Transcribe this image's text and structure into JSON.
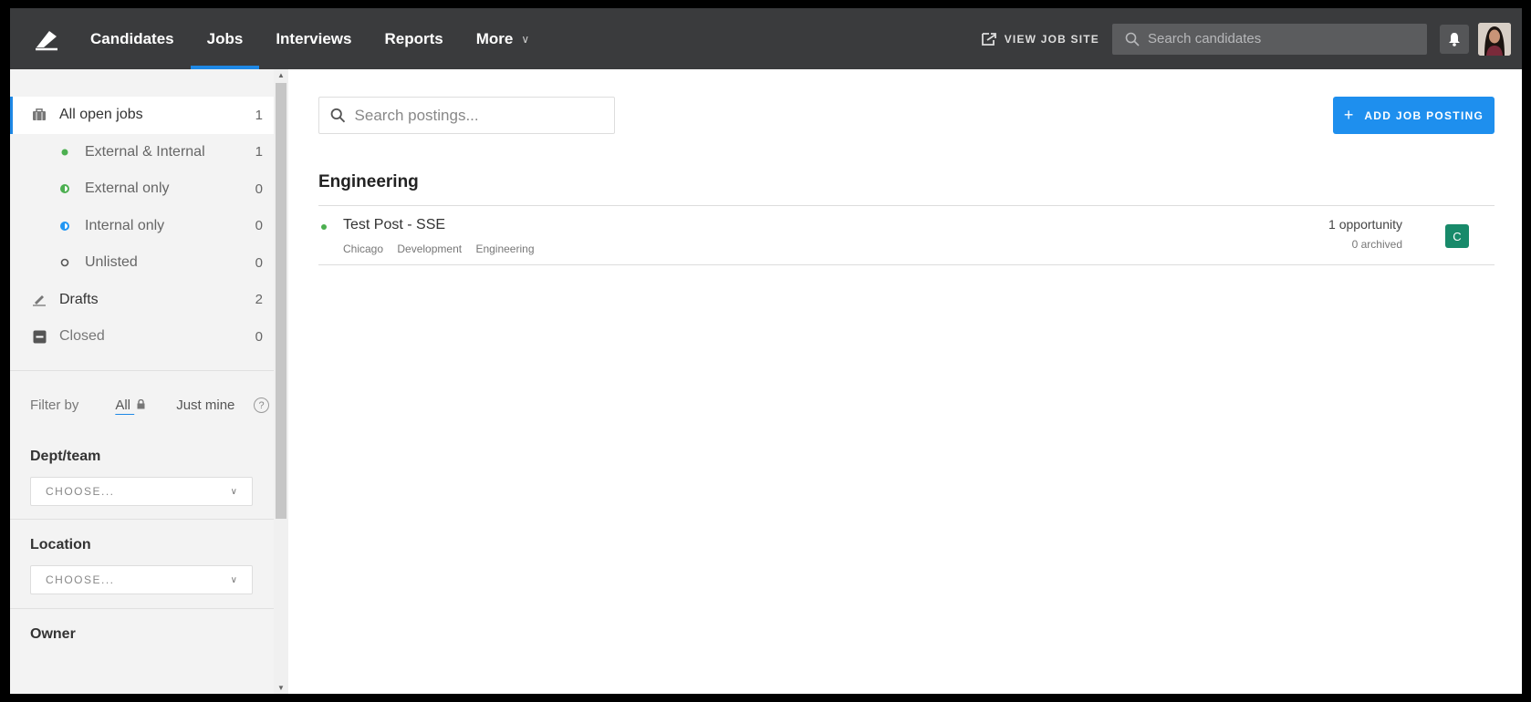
{
  "nav": {
    "items": [
      {
        "label": "Candidates"
      },
      {
        "label": "Jobs"
      },
      {
        "label": "Interviews"
      },
      {
        "label": "Reports"
      },
      {
        "label": "More"
      }
    ],
    "view_job_site": "VIEW JOB SITE",
    "search_placeholder": "Search candidates"
  },
  "sidebar": {
    "jobs": [
      {
        "label": "All open jobs",
        "count": "1",
        "icon": "briefcase-icon"
      },
      {
        "label": "External & Internal",
        "count": "1",
        "icon": "green-dot-icon"
      },
      {
        "label": "External only",
        "count": "0",
        "icon": "half-green-dot-icon"
      },
      {
        "label": "Internal only",
        "count": "0",
        "icon": "half-blue-dot-icon"
      },
      {
        "label": "Unlisted",
        "count": "0",
        "icon": "hollow-dot-icon"
      },
      {
        "label": "Drafts",
        "count": "2",
        "icon": "pencil-icon"
      },
      {
        "label": "Closed",
        "count": "0",
        "icon": "closed-icon"
      }
    ],
    "filter": {
      "label": "Filter by",
      "options": [
        "All",
        "Just mine"
      ],
      "help": "?"
    },
    "groups": [
      {
        "title": "Dept/team",
        "select": "CHOOSE..."
      },
      {
        "title": "Location",
        "select": "CHOOSE..."
      },
      {
        "title": "Owner"
      }
    ]
  },
  "main": {
    "search_placeholder": "Search postings...",
    "add_button": "ADD JOB POSTING",
    "department": "Engineering",
    "postings": [
      {
        "title": "Test Post - SSE",
        "tags": [
          "Chicago",
          "Development",
          "Engineering"
        ],
        "opportunities": "1 opportunity",
        "archived": "0 archived",
        "owner_initial": "C"
      }
    ]
  },
  "colors": {
    "nav_bg": "#3a3b3d",
    "accent": "#1e88e5",
    "button": "#1e8fee",
    "owner_badge": "#188a6a",
    "status_green": "#4caf50"
  }
}
